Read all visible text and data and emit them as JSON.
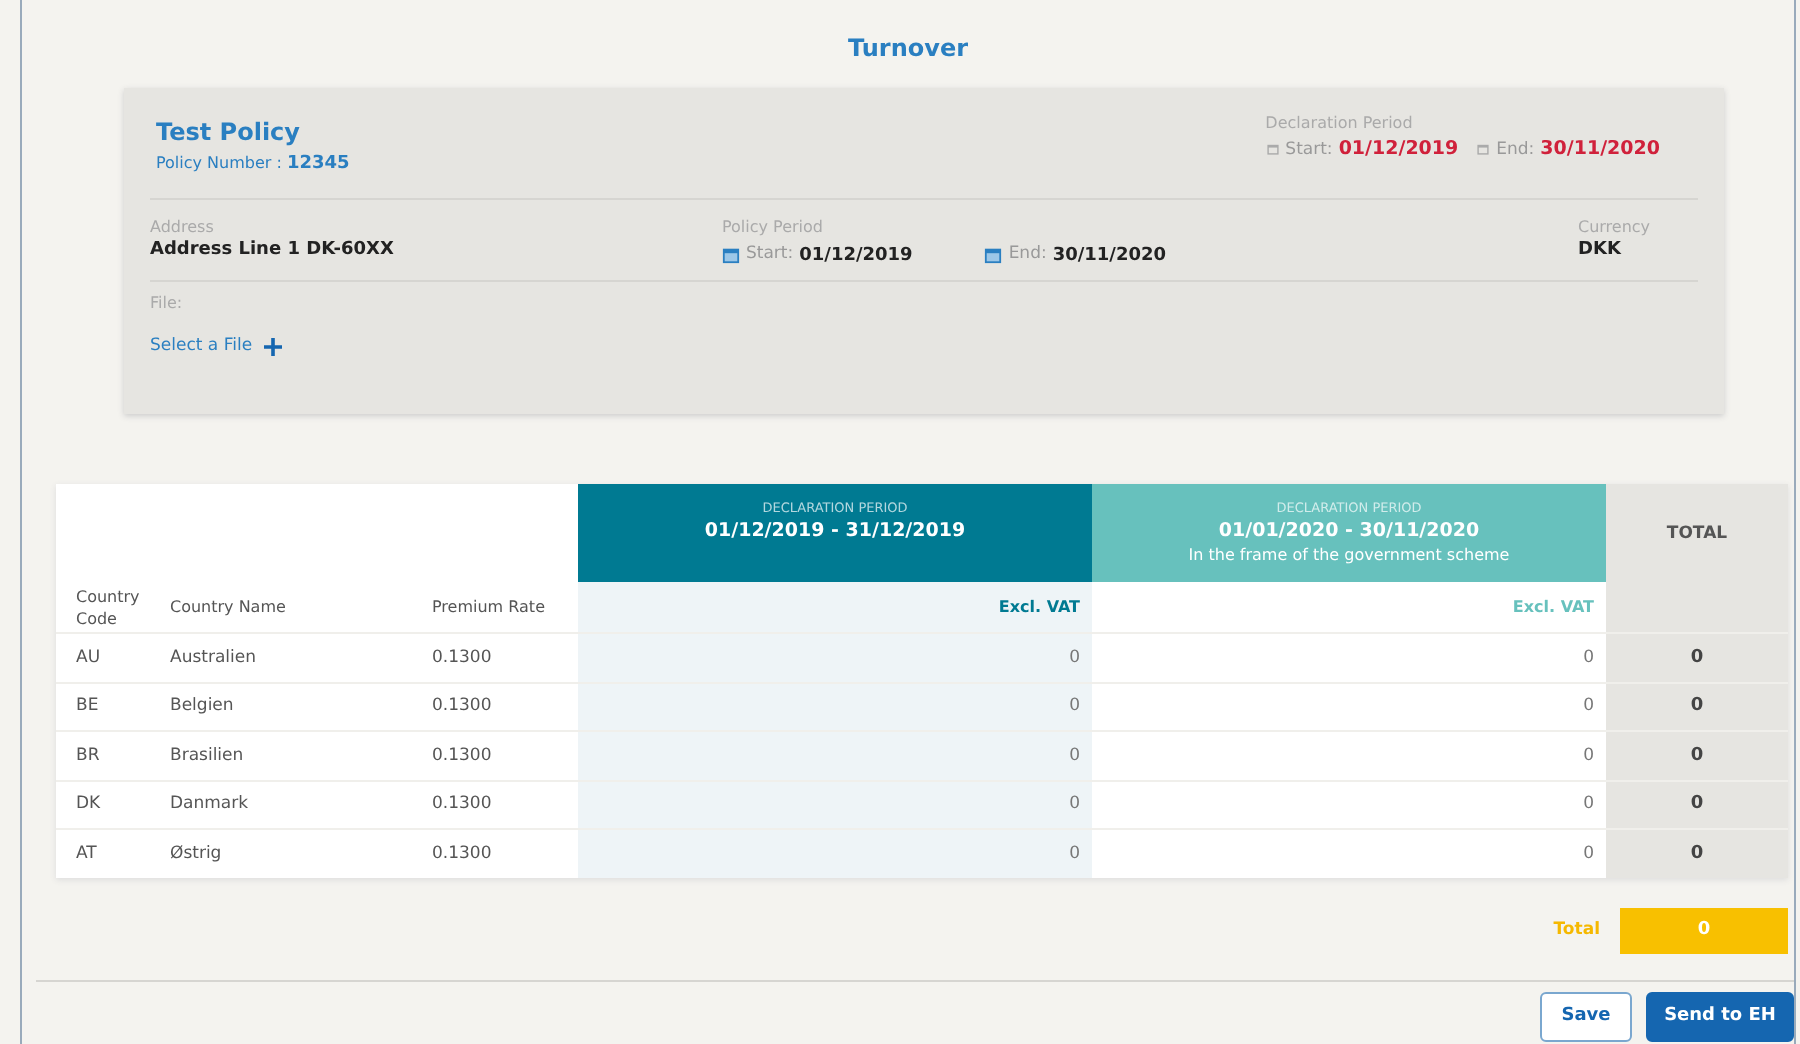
{
  "title": "Turnover",
  "policy": {
    "name": "Test Policy",
    "number_label": "Policy Number :",
    "number": "12345",
    "declaration_period": {
      "label": "Declaration Period",
      "start_label": "Start:",
      "start": "01/12/2019",
      "end_label": "End:",
      "end": "30/11/2020"
    },
    "address": {
      "label": "Address",
      "value": "Address Line 1 DK-60XX"
    },
    "policy_period": {
      "label": "Policy Period",
      "start_label": "Start:",
      "start": "01/12/2019",
      "end_label": "End:",
      "end": "30/11/2020"
    },
    "currency": {
      "label": "Currency",
      "value": "DKK"
    },
    "file": {
      "label": "File:",
      "link": "Select a File"
    }
  },
  "table": {
    "columns": [
      "Country\nCode",
      "Country Name",
      "Premium Rate"
    ],
    "periods": [
      {
        "caption": "DECLARATION PERIOD",
        "range": "01/12/2019 - 31/12/2019",
        "subheader": "Excl. VAT",
        "color": "#007a92"
      },
      {
        "caption": "DECLARATION PERIOD",
        "range": "01/01/2020 - 30/11/2020",
        "note": "In the frame of the government scheme",
        "subheader": "Excl. VAT",
        "color": "#67c1bd"
      }
    ],
    "total_header": "TOTAL",
    "rows": [
      {
        "code": "AU",
        "name": "Australien",
        "rate": "0.1300",
        "values": [
          "0",
          "0"
        ],
        "total": "0"
      },
      {
        "code": "BE",
        "name": "Belgien",
        "rate": "0.1300",
        "values": [
          "0",
          "0"
        ],
        "total": "0"
      },
      {
        "code": "BR",
        "name": "Brasilien",
        "rate": "0.1300",
        "values": [
          "0",
          "0"
        ],
        "total": "0"
      },
      {
        "code": "DK",
        "name": "Danmark",
        "rate": "0.1300",
        "values": [
          "0",
          "0"
        ],
        "total": "0"
      },
      {
        "code": "AT",
        "name": "Østrig",
        "rate": "0.1300",
        "values": [
          "0",
          "0"
        ],
        "total": "0"
      }
    ]
  },
  "grand_total": {
    "label": "Total",
    "value": "0"
  },
  "buttons": [
    {
      "label": "Save",
      "kind": "secondary"
    },
    {
      "label": "Send to EH",
      "kind": "primary"
    }
  ]
}
